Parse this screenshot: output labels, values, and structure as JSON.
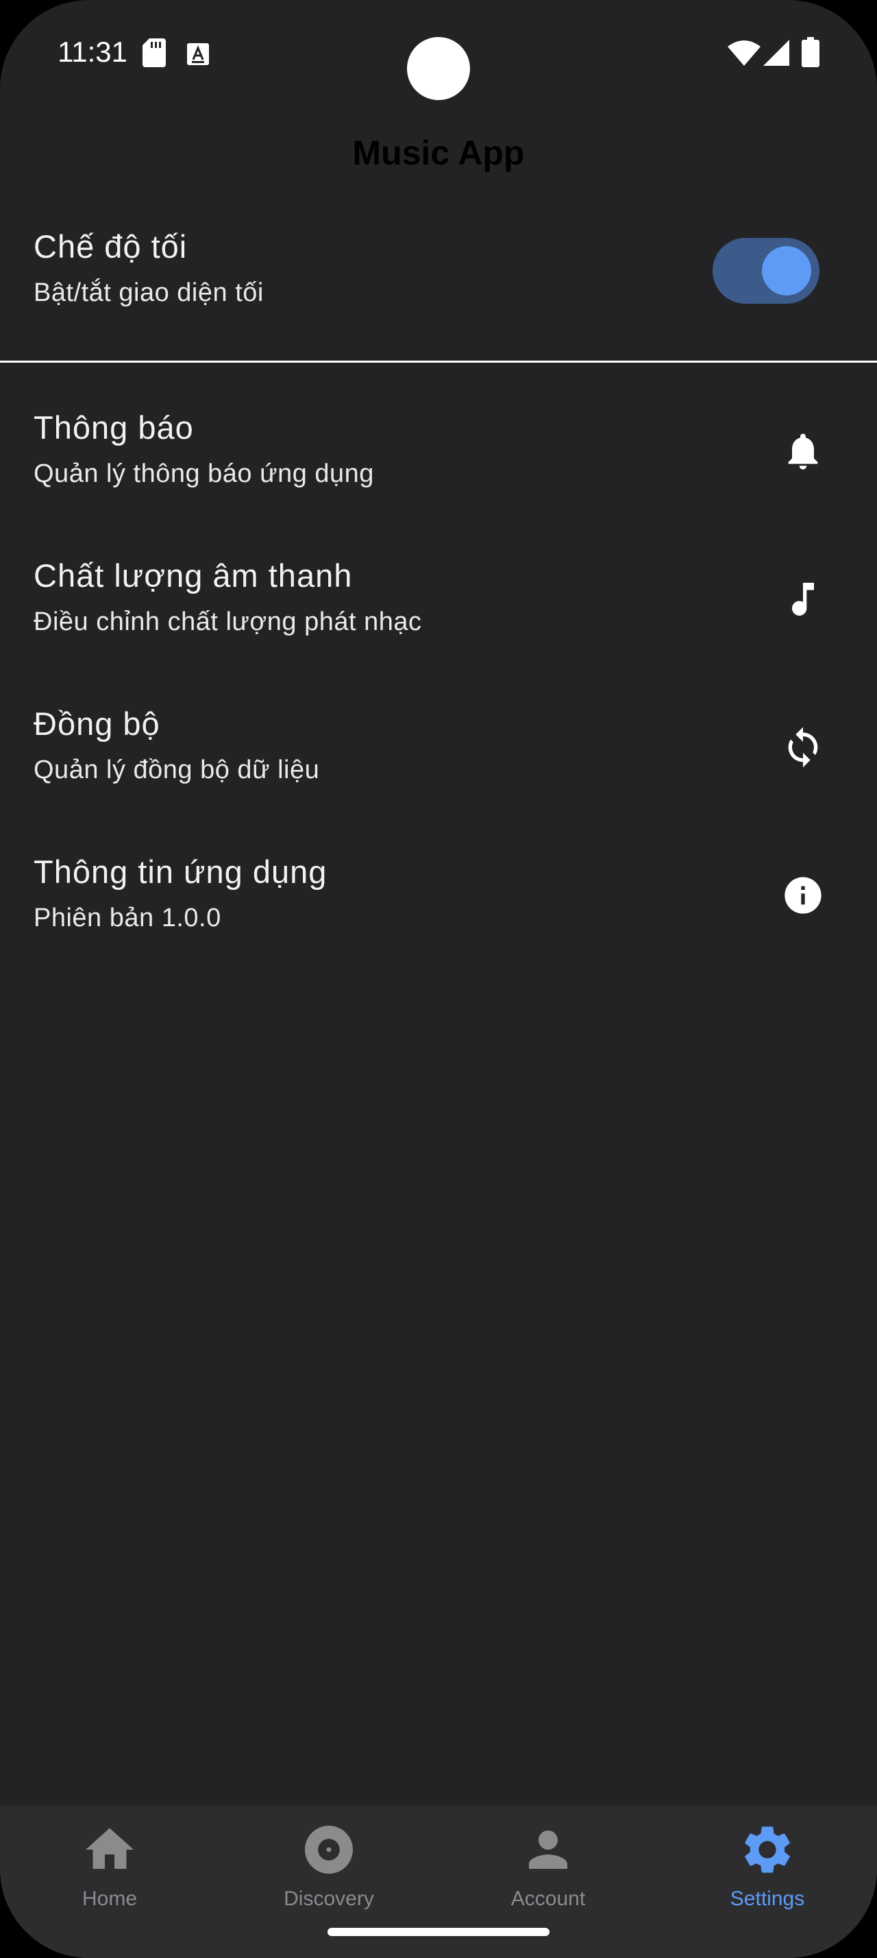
{
  "status_bar": {
    "time": "11:31",
    "left_icons": [
      "sd-card-icon",
      "keyboard-a-icon"
    ],
    "right_icons": [
      "wifi-icon",
      "cellular-signal-icon",
      "battery-icon"
    ]
  },
  "app_bar": {
    "title": "Music App"
  },
  "dark_mode": {
    "title": "Chế độ tối",
    "subtitle": "Bật/tắt giao diện tối",
    "enabled": true
  },
  "settings_items": [
    {
      "title": "Thông báo",
      "subtitle": "Quản lý thông báo ứng dụng",
      "icon": "bell-icon"
    },
    {
      "title": "Chất lượng âm thanh",
      "subtitle": "Điều chỉnh chất lượng phát nhạc",
      "icon": "music-note-icon"
    },
    {
      "title": "Đồng bộ",
      "subtitle": "Quản lý đồng bộ dữ liệu",
      "icon": "sync-icon"
    },
    {
      "title": "Thông tin ứng dụng",
      "subtitle": "Phiên bản 1.0.0",
      "icon": "info-icon"
    }
  ],
  "bottom_nav": {
    "items": [
      {
        "label": "Home",
        "icon": "home-icon"
      },
      {
        "label": "Discovery",
        "icon": "disc-icon"
      },
      {
        "label": "Account",
        "icon": "person-icon"
      },
      {
        "label": "Settings",
        "icon": "gear-icon"
      }
    ],
    "active": "Settings"
  },
  "colors": {
    "background": "#232325",
    "nav_background": "#2d2d30",
    "accent": "#5d9bf5",
    "toggle_track": "#3c5a8a",
    "inactive_nav": "#8b8b8e"
  }
}
